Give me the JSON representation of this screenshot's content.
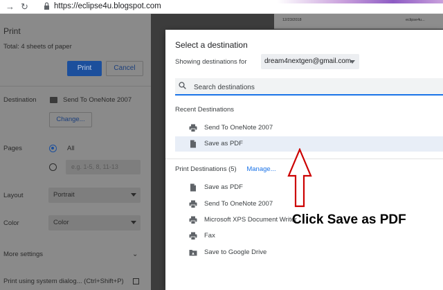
{
  "browser": {
    "url": "https://eclipse4u.blogspot.com",
    "icons": [
      "back-arrow-icon",
      "reload-icon",
      "lock-icon"
    ]
  },
  "print_panel": {
    "title": "Print",
    "total": "Total: 4 sheets of paper",
    "print_button": "Print",
    "cancel_button": "Cancel",
    "destination_label": "Destination",
    "destination_value": "Send To OneNote 2007",
    "change_button": "Change...",
    "pages_label": "Pages",
    "pages_all": "All",
    "pages_placeholder": "e.g. 1-5, 8, 11-13",
    "layout_label": "Layout",
    "layout_value": "Portrait",
    "color_label": "Color",
    "color_value": "Color",
    "more_settings": "More settings",
    "system_dialog": "Print using system dialog... (Ctrl+Shift+P)"
  },
  "preview": {
    "sheet_left": "12/23/2018",
    "sheet_right": "eclipse4u..."
  },
  "dialog": {
    "title": "Select a destination",
    "showing_label": "Showing destinations for",
    "account": "dream4nextgen@gmail.com",
    "search_placeholder": "Search destinations",
    "recent_heading": "Recent Destinations",
    "recent": [
      {
        "label": "Send To OneNote 2007",
        "icon": "printer-icon"
      },
      {
        "label": "Save as PDF",
        "icon": "document-icon",
        "selected": true
      }
    ],
    "print_heading": "Print Destinations",
    "print_count": "(5)",
    "manage_link": "Manage...",
    "print_destinations": [
      {
        "label": "Save as PDF",
        "icon": "document-icon"
      },
      {
        "label": "Send To OneNote 2007",
        "icon": "printer-icon"
      },
      {
        "label": "Microsoft XPS Document Writer",
        "icon": "printer-icon"
      },
      {
        "label": "Fax",
        "icon": "printer-icon"
      },
      {
        "label": "Save to Google Drive",
        "icon": "drive-folder-icon"
      }
    ]
  },
  "annotation": {
    "text": "Click Save as PDF",
    "color": "#cc0000"
  },
  "colors": {
    "accent": "#1a73e8",
    "print_button": "#1c4f9c",
    "overlay": "#8a8a8a",
    "annotation": "#cc0000"
  }
}
